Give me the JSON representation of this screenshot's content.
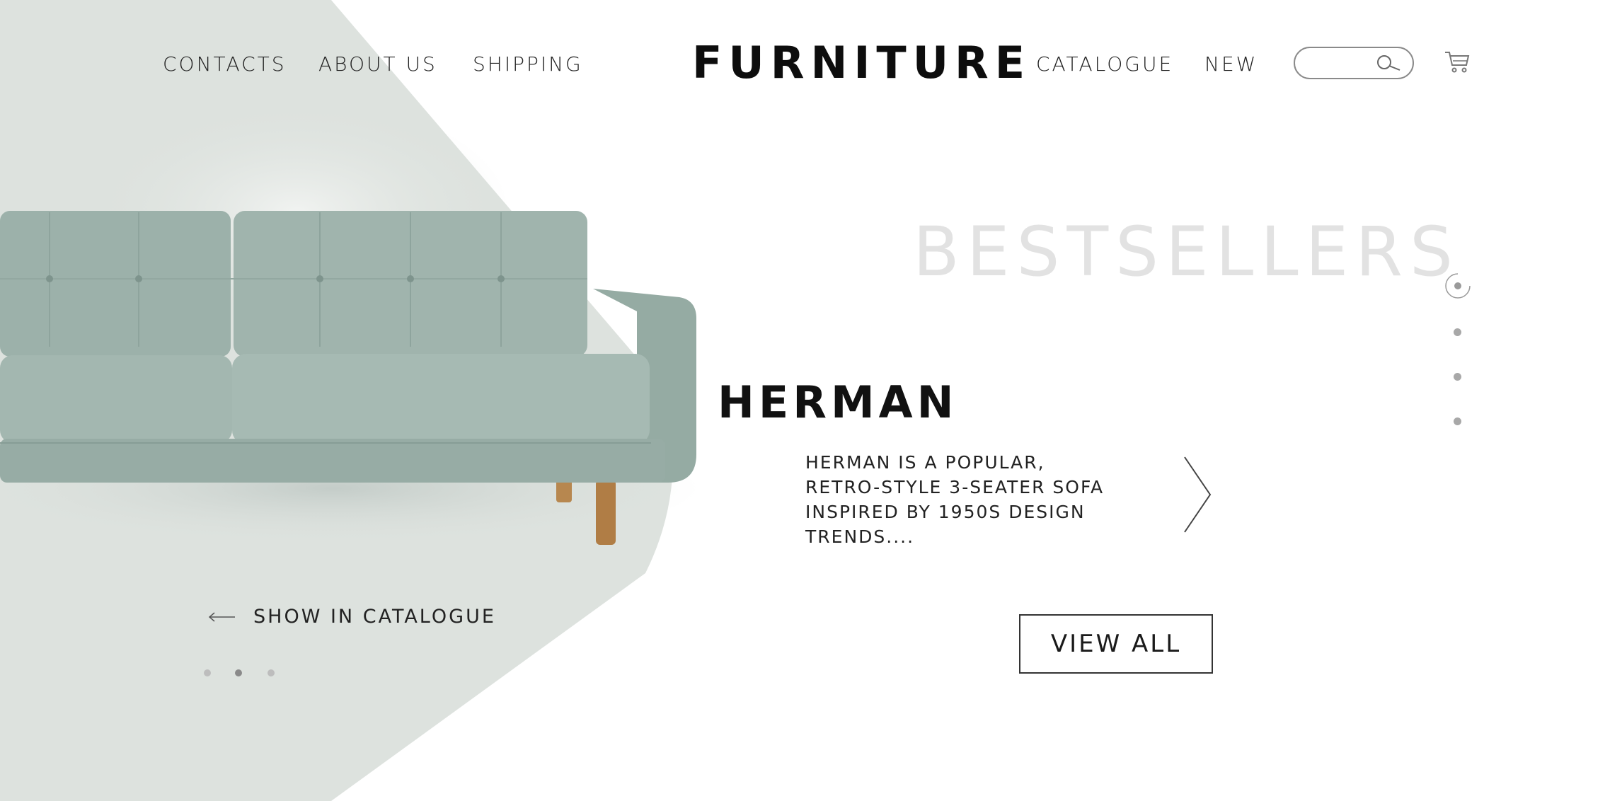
{
  "nav": {
    "left": [
      "CONTACTS",
      "ABOUT US",
      "SHIPPING"
    ],
    "right": [
      "CATALOGUE",
      "NEW"
    ]
  },
  "brand": {
    "logo": "FURNITURE"
  },
  "search": {
    "placeholder": "",
    "icon": "search-icon"
  },
  "cart": {
    "icon": "cart-icon"
  },
  "hero": {
    "section_title": "BESTSELLERS",
    "product_name": "HERMAN",
    "product_description": "HERMAN IS A POPULAR, RETRO-STYLE 3-SEATER SOFA INSPIRED BY 1950S DESIGN TRENDS....",
    "view_all_label": "VIEW ALL",
    "show_in_catalogue_label": "SHOW IN CATALOGUE"
  },
  "slider": {
    "side_pages": 4,
    "side_active_index": 0,
    "bottom_pages": 3,
    "bottom_active_index": 1
  },
  "colors": {
    "accent_shape": "#dde2de",
    "sofa": "#9fb3ac",
    "sofa_legs": "#b7874f",
    "text": "#1a1a1a",
    "muted_title": "#e2e2e2"
  }
}
